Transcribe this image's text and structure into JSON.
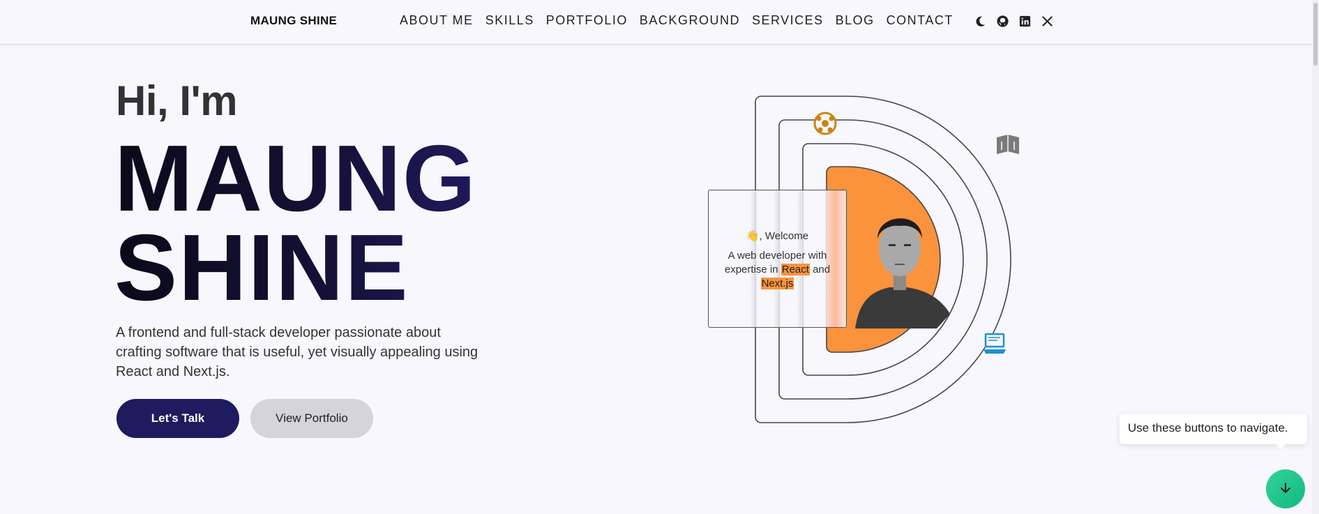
{
  "header": {
    "brand": "MAUNG SHINE",
    "nav": [
      "ABOUT ME",
      "SKILLS",
      "PORTFOLIO",
      "BACKGROUND",
      "SERVICES",
      "BLOG",
      "CONTACT"
    ],
    "icons": [
      "moon-icon",
      "github-icon",
      "linkedin-icon",
      "x-icon"
    ]
  },
  "hero": {
    "greeting": "Hi, I'm",
    "name_line1": "MAUNG",
    "name_line2": "SHINE",
    "tagline": "A frontend and full-stack developer passionate about crafting software that is useful, yet visually appealing using React and Next.js.",
    "primary_button": "Let's Talk",
    "secondary_button": "View Portfolio"
  },
  "card": {
    "title": "👋, Welcome",
    "text_before": "A web developer with expertise in ",
    "highlight1": "React",
    "text_middle": " and ",
    "highlight2": "Next.js"
  },
  "tooltip": "Use these buttons to navigate.",
  "colors": {
    "accent": "#fb923c",
    "primary": "#1e1b5e",
    "fab": "#10b981",
    "background": "#f8f7fe"
  },
  "decor_icons": [
    "soccer-ball-icon",
    "book-icon",
    "laptop-icon"
  ]
}
